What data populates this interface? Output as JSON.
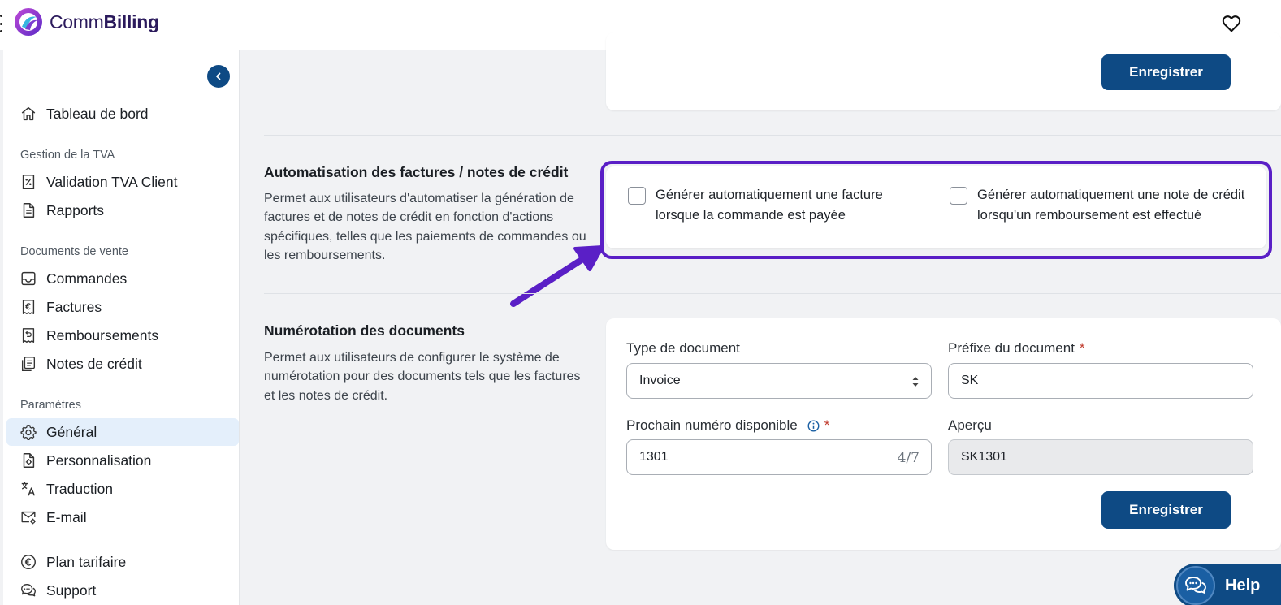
{
  "app": {
    "brand_light": "Comm",
    "brand_bold": "Billing"
  },
  "sidebar": {
    "dashboard": "Tableau de bord",
    "vat_section": "Gestion de la TVA",
    "vat_validation": "Validation TVA Client",
    "reports": "Rapports",
    "sales_section": "Documents de vente",
    "orders": "Commandes",
    "invoices": "Factures",
    "refunds": "Remboursements",
    "credit_notes": "Notes de crédit",
    "settings_section": "Paramètres",
    "general": "Général",
    "customization": "Personnalisation",
    "translation": "Traduction",
    "email": "E-mail",
    "plan": "Plan tarifaire",
    "support": "Support"
  },
  "top_card": {
    "save_label": "Enregistrer"
  },
  "automation": {
    "title": "Automatisation des factures / notes de crédit",
    "description": "Permet aux utilisateurs d'automatiser la génération de factures et de notes de crédit en fonction d'actions spécifiques, telles que les paiements de commandes ou les remboursements.",
    "option_invoice": "Générer automatiquement une facture lorsque la commande est payée",
    "option_credit": "Générer automatiquement une note de crédit lorsqu'un remboursement est effectué"
  },
  "numbering": {
    "title": "Numérotation des documents",
    "description": "Permet aux utilisateurs de configurer le système de numérotation pour des documents tels que les factures et les notes de crédit.",
    "doc_type_label": "Type de document",
    "doc_type_value": "Invoice",
    "prefix_label": "Préfixe du document",
    "prefix_value": "SK",
    "next_number_label": "Prochain numéro disponible",
    "next_number_value": "1301",
    "counter": "4/7",
    "preview_label": "Aperçu",
    "preview_value": "SK1301",
    "required_mark": "*",
    "save_label": "Enregistrer"
  },
  "help": {
    "label": "Help"
  },
  "colors": {
    "primary": "#0e4a84",
    "highlight": "#5a1fc6",
    "active_bg": "#e4effb"
  }
}
